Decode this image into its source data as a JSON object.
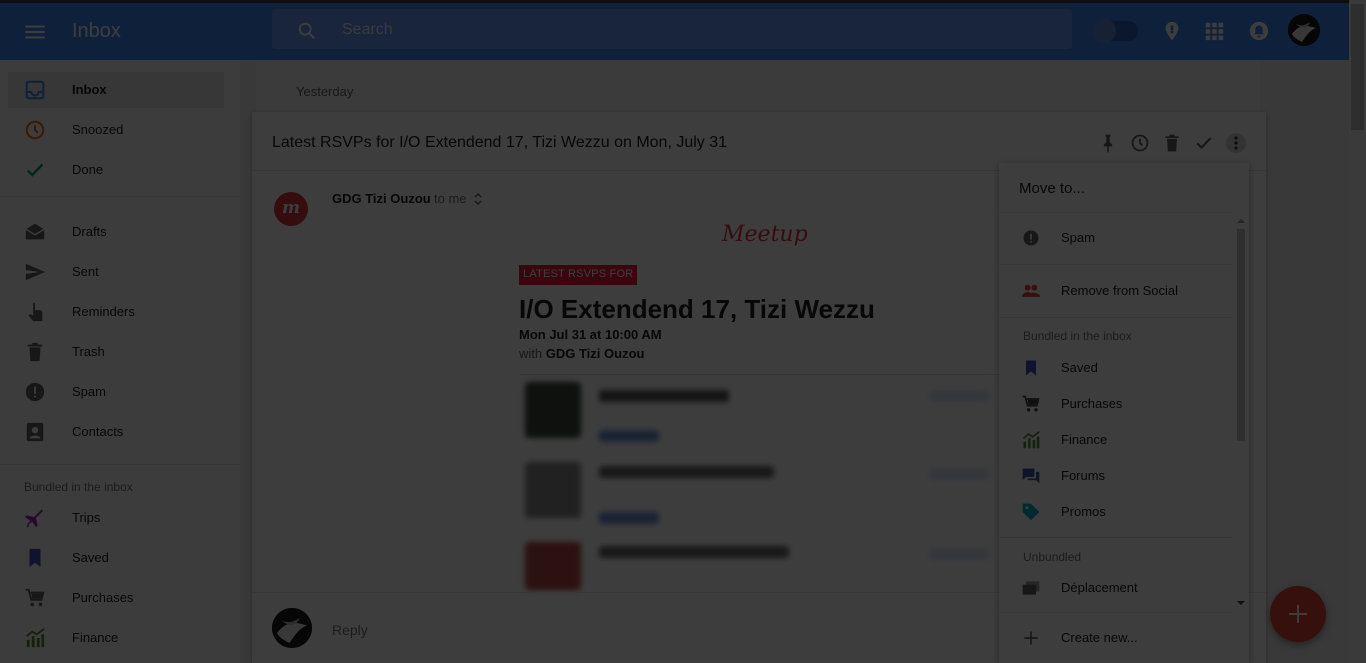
{
  "header": {
    "app_title": "Inbox",
    "search_placeholder": "Search"
  },
  "sidebar": {
    "items": [
      {
        "label": "Inbox",
        "icon": "inbox-icon",
        "color": "#4285f4"
      },
      {
        "label": "Snoozed",
        "icon": "clock-icon",
        "color": "#ef6c00"
      },
      {
        "label": "Done",
        "icon": "check-icon",
        "color": "#0f9d58"
      },
      {
        "label": "Drafts",
        "icon": "drafts-icon",
        "color": "#616161"
      },
      {
        "label": "Sent",
        "icon": "send-icon",
        "color": "#616161"
      },
      {
        "label": "Reminders",
        "icon": "reminder-hand-icon",
        "color": "#616161"
      },
      {
        "label": "Trash",
        "icon": "trash-icon",
        "color": "#616161"
      },
      {
        "label": "Spam",
        "icon": "alert-icon",
        "color": "#616161"
      },
      {
        "label": "Contacts",
        "icon": "contacts-icon",
        "color": "#616161"
      }
    ],
    "bundled_section": "Bundled in the inbox",
    "bundles": [
      {
        "label": "Trips",
        "icon": "airplane-icon",
        "color": "#9c27b0"
      },
      {
        "label": "Saved",
        "icon": "bookmark-icon",
        "color": "#3f51b5"
      },
      {
        "label": "Purchases",
        "icon": "cart-icon",
        "color": "#616161"
      },
      {
        "label": "Finance",
        "icon": "finance-chart-icon",
        "color": "#558b2f"
      }
    ]
  },
  "main": {
    "day_label": "Yesterday",
    "email": {
      "subject": "Latest RSVPs for I/O Extendend 17, Tizi Wezzu on Mon, July 31",
      "sender": "GDG Tizi Ouzou",
      "recipient": "to me",
      "logo_text": "Meetup",
      "banner": "LATEST RSVPS FOR",
      "event_title": "I/O Extendend 17, Tizi Wezzu",
      "event_date": "Mon Jul 31 at 10:00 AM",
      "with_prefix": "with",
      "with_group": "GDG Tizi Ouzou",
      "reply_label": "Reply"
    }
  },
  "move_menu": {
    "title": "Move to...",
    "items_top": [
      {
        "label": "Spam",
        "icon": "alert-icon",
        "color": "#616161"
      },
      {
        "label": "Remove from Social",
        "icon": "people-icon",
        "color": "#db4437"
      }
    ],
    "bundled_section": "Bundled in the inbox",
    "bundles": [
      {
        "label": "Saved",
        "icon": "bookmark-icon",
        "color": "#3f51b5"
      },
      {
        "label": "Purchases",
        "icon": "cart-icon",
        "color": "#424242"
      },
      {
        "label": "Finance",
        "icon": "finance-chart-icon",
        "color": "#558b2f"
      },
      {
        "label": "Forums",
        "icon": "forum-icon",
        "color": "#3f51b5"
      },
      {
        "label": "Promos",
        "icon": "tag-icon",
        "color": "#00acc1"
      }
    ],
    "unbundled_section": "Unbundled",
    "unbundled": [
      {
        "label": "Déplacement",
        "icon": "label-stack-icon",
        "color": "#616161"
      }
    ],
    "create_new": "Create new..."
  }
}
